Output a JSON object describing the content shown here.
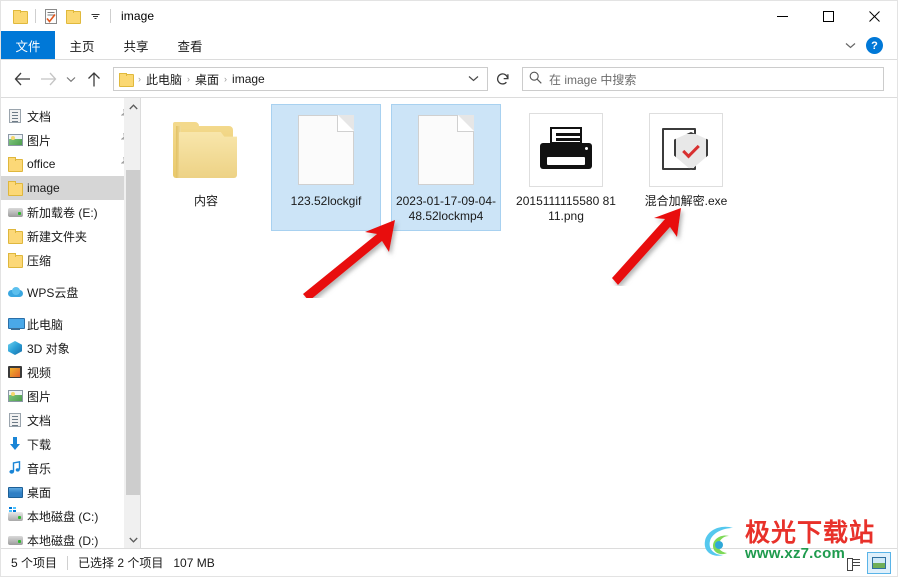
{
  "window": {
    "title": "image",
    "quick_access": [
      {
        "name": "folder-icon",
        "label": ""
      },
      {
        "name": "properties-icon",
        "label": ""
      },
      {
        "name": "new-folder-icon",
        "label": ""
      },
      {
        "name": "customize-dropdown-icon",
        "label": "▾"
      }
    ],
    "controls": {
      "minimize": "–",
      "maximize": "☐",
      "close": "✕"
    }
  },
  "ribbon": {
    "tabs": [
      {
        "label": "文件",
        "active": true
      },
      {
        "label": "主页",
        "active": false
      },
      {
        "label": "共享",
        "active": false
      },
      {
        "label": "查看",
        "active": false
      }
    ],
    "expand_icon": "⌄",
    "help_icon": "?"
  },
  "navbar": {
    "back_icon": "←",
    "forward_icon": "→",
    "recent_icon": "⌄",
    "up_icon": "↑",
    "breadcrumb": [
      "此电脑",
      "桌面",
      "image"
    ],
    "breadcrumb_separator": "›",
    "address_dropdown_icon": "⌄",
    "refresh_icon": "↻",
    "search": {
      "icon": "search-icon",
      "placeholder": "在 image 中搜索",
      "value": ""
    }
  },
  "sidebar": {
    "items": [
      {
        "label": "文档",
        "icon": "document-icon",
        "pinned": true,
        "selected": false,
        "indent": 1
      },
      {
        "label": "图片",
        "icon": "pictures-icon",
        "pinned": true,
        "selected": false,
        "indent": 1
      },
      {
        "label": "office",
        "icon": "folder-icon",
        "pinned": true,
        "selected": false,
        "indent": 1
      },
      {
        "label": "image",
        "icon": "folder-icon",
        "pinned": false,
        "selected": true,
        "indent": 1
      },
      {
        "label": "新加载卷 (E:)",
        "icon": "drive-icon",
        "pinned": false,
        "selected": false,
        "indent": 1
      },
      {
        "label": "新建文件夹",
        "icon": "folder-icon",
        "pinned": false,
        "selected": false,
        "indent": 1
      },
      {
        "label": "压缩",
        "icon": "folder-icon",
        "pinned": false,
        "selected": false,
        "indent": 1
      },
      {
        "label": "WPS云盘",
        "icon": "cloud-icon",
        "pinned": false,
        "selected": false,
        "indent": 0,
        "gap_before": true
      },
      {
        "label": "此电脑",
        "icon": "this-pc-icon",
        "pinned": false,
        "selected": false,
        "indent": 0,
        "gap_before": true
      },
      {
        "label": "3D 对象",
        "icon": "3d-objects-icon",
        "pinned": false,
        "selected": false,
        "indent": 1
      },
      {
        "label": "视频",
        "icon": "videos-icon",
        "pinned": false,
        "selected": false,
        "indent": 1
      },
      {
        "label": "图片",
        "icon": "pictures-icon",
        "pinned": false,
        "selected": false,
        "indent": 1
      },
      {
        "label": "文档",
        "icon": "document-icon",
        "pinned": false,
        "selected": false,
        "indent": 1
      },
      {
        "label": "下载",
        "icon": "downloads-icon",
        "pinned": false,
        "selected": false,
        "indent": 1
      },
      {
        "label": "音乐",
        "icon": "music-icon",
        "pinned": false,
        "selected": false,
        "indent": 1
      },
      {
        "label": "桌面",
        "icon": "desktop-icon",
        "pinned": false,
        "selected": false,
        "indent": 1
      },
      {
        "label": "本地磁盘 (C:)",
        "icon": "system-drive-icon",
        "pinned": false,
        "selected": false,
        "indent": 1
      },
      {
        "label": "本地磁盘 (D:)",
        "icon": "drive-icon",
        "pinned": false,
        "selected": false,
        "indent": 1
      }
    ],
    "pin_icon": "📌",
    "scroll_up_icon": "⌃",
    "scroll_down_icon": "⌄"
  },
  "files": [
    {
      "name": "内容",
      "type": "folder",
      "icon": "folder-large-icon",
      "selected": false
    },
    {
      "name": "123.52lockgif",
      "type": "file",
      "icon": "generic-file-icon",
      "selected": true
    },
    {
      "name": "2023-01-17-09-04-48.52lockmp4",
      "type": "file",
      "icon": "generic-file-icon",
      "selected": true
    },
    {
      "name": "2015111115580 8111.png",
      "type": "image",
      "icon": "png-thumbnail-printer",
      "selected": false
    },
    {
      "name": "混合加解密.exe",
      "type": "executable",
      "icon": "shield-document-icon",
      "selected": false
    }
  ],
  "statusbar": {
    "item_count": "5 个项目",
    "selection": "已选择 2 个项目",
    "size": "107 MB",
    "view_details_icon": "details-view-icon",
    "view_thumbnails_icon": "thumbnail-view-icon"
  },
  "watermark": {
    "title": "极光下载站",
    "url": "www.xz7.com"
  },
  "annotations": [
    {
      "name": "red-arrow-left",
      "target": "2023-01-17-09-04-48.52lockmp4"
    },
    {
      "name": "red-arrow-right",
      "target": "混合加解密.exe"
    }
  ],
  "colors": {
    "accent": "#0078d7",
    "selection": "#cce4f7",
    "selection_border": "#a8d1f0",
    "sidebar_selection": "#d6d6d6",
    "annotation_red": "#e81010",
    "watermark_red": "#e8312a",
    "watermark_green": "#1f9b4e"
  }
}
